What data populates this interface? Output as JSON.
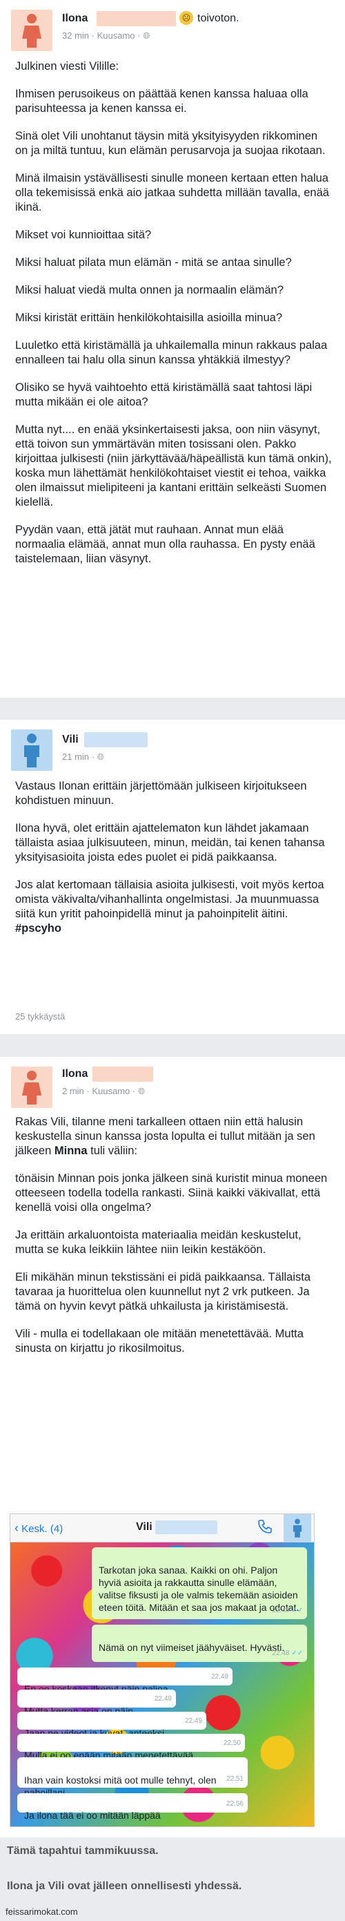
{
  "post1": {
    "author": "Ilona",
    "feeling_text": "toivoton.",
    "time": "32 min",
    "location": "Kuusamo",
    "paragraphs": [
      "Julkinen viesti Vilille:",
      "Ihmisen perusoikeus on päättää kenen kanssa haluaa olla parisuhteessa ja kenen kanssa ei.",
      "Sinä olet Vili unohtanut täysin mitä yksityisyyden rikkominen on ja miltä tuntuu, kun elämän perusarvoja ja suojaa rikotaan.",
      "Minä ilmaisin ystävällisesti sinulle moneen kertaan etten halua olla tekemisissä enkä aio jatkaa suhdetta millään tavalla, enää ikinä.",
      "Mikset voi kunnioittaa sitä?",
      "Miksi haluat pilata mun elämän - mitä se antaa sinulle?",
      "Miksi haluat viedä multa onnen ja normaalin elämän?",
      "Miksi kiristät erittäin henkilökohtaisilla asioilla minua?",
      "Luuletko että kiristämällä ja uhkailemalla minun rakkaus palaa ennalleen tai halu olla sinun kanssa yhtäkkiä ilmestyy?",
      "Olisiko se hyvä vaihtoehto että kiristämällä saat tahtosi läpi mutta mikään ei ole aitoa?",
      "Mutta nyt.... en enää yksinkertaisesti jaksa, oon niin väsynyt, että toivon sun ymmärtävän miten tosissani olen. Pakko kirjoittaa julkisesti (niin järkyttävää/häpeällistä kun tämä onkin), koska mun lähettämät henkilökohtaiset viestit ei tehoa, vaikka olen ilmaissut mielipiteeni ja kantani erittäin selkeästi Suomen kielellä.",
      "Pyydän vaan, että jätät mut rauhaan. Annat mun elää normaalia elämää, annat mun olla rauhassa. En pysty enää taistelemaan, liian väsynyt."
    ]
  },
  "post2": {
    "author": "Vili",
    "time": "21 min",
    "paragraphs": [
      "Vastaus Ilonan erittäin järjettömään julkiseen kirjoitukseen kohdistuen minuun.",
      "Ilona hyvä, olet erittäin ajattelematon kun lähdet jakamaan tällaista asiaa julkisuuteen, minun, meidän, tai kenen tahansa yksityisasioita joista edes puolet ei pidä paikkaansa.",
      "Jos alat kertomaan tällaisia asioita julkisesti, voit myös kertoa omista väkivalta/vihanhallinta ongelmistasi. Ja muunmuassa siitä kun yritit pahoinpidellä minut ja pahoinpitelit äitini. #pscyho"
    ],
    "likes": "25 tykkäystä"
  },
  "post3": {
    "author": "Ilona",
    "time": "2 min",
    "location": "Kuusamo",
    "paragraphs": [
      "Rakas Vili, tilanne meni tarkalleen ottaen niin että halusin keskustella sinun kanssa josta lopulta ei tullut mitään ja sen jälkeen Minna tuli väliin:",
      "tönäisin Minnan pois jonka jälkeen sinä kuristit minua moneen otteeseen todella todella rankasti. Siinä kaikki väkivallat, että kenellä voisi olla ongelma?",
      "Ja erittäin arkaluontoista materiaalia meidän keskustelut, mutta se kuka leikkiin lähtee niin leikin kestäköön.",
      "Eli mikähän minun tekstissäni ei pidä paikkaansa. Tällaista tavaraa ja huorittelua olen kuunnellut nyt 2 vrk putkeen. Ja tämä on hyvin kevyt pätkä uhkailusta ja kiristämisestä.",
      "Vili - mulla ei todellakaan ole mitään menetettävää. Mutta sinusta on kirjattu jo rikosilmoitus."
    ],
    "minna": "Minna"
  },
  "chat": {
    "back_label": "Kesk. (4)",
    "contact": "Vili",
    "messages": [
      {
        "dir": "out",
        "text": "Tarkotan joka sanaa. Kaikki on ohi. Paljon hyviä asioita ja rakkautta sinulle elämään, valitse fiksusti ja ole valmis tekemään asioiden eteen töitä. Mitään et saa jos makaat ja odotat.",
        "time": "22.48"
      },
      {
        "dir": "out",
        "text": "Nämä on nyt viimeiset jäähyväiset. Hyvästi.",
        "time": "22.48"
      },
      {
        "dir": "in",
        "text": "En oo koskaan itkenyt näin paljoa",
        "time": "22.49"
      },
      {
        "dir": "in",
        "text": "Mutta kerran asia on näin",
        "time": "22.49"
      },
      {
        "dir": "in",
        "text": "Jaan ne videot ja kuvat, anteeksi",
        "time": "22.49"
      },
      {
        "dir": "in",
        "text": "Mulla ei oo enään mitään menetettävää",
        "time": "22.50"
      },
      {
        "dir": "in",
        "text": "Ihan vain kostoksi mitä oot mulle tehnyt, olen pahoillani",
        "time": "22.51"
      },
      {
        "dir": "in",
        "text": "Ja ilona tää ei oo mitään läppää",
        "time": "22.56"
      }
    ]
  },
  "footer": {
    "line1": "Tämä tapahtui tammikuussa.",
    "line2": "Ilona ja Vili ovat jälleen onnellisesti yhdessä.",
    "watermark": "feissarimokat.com"
  },
  "colors": {
    "female_avatar_bg": "#fad7c7",
    "male_avatar_bg": "#b9d9f2",
    "blur_female": "#f9d6c5",
    "blur_male": "#cde3f5",
    "ios_blue": "#1a7bf0"
  }
}
